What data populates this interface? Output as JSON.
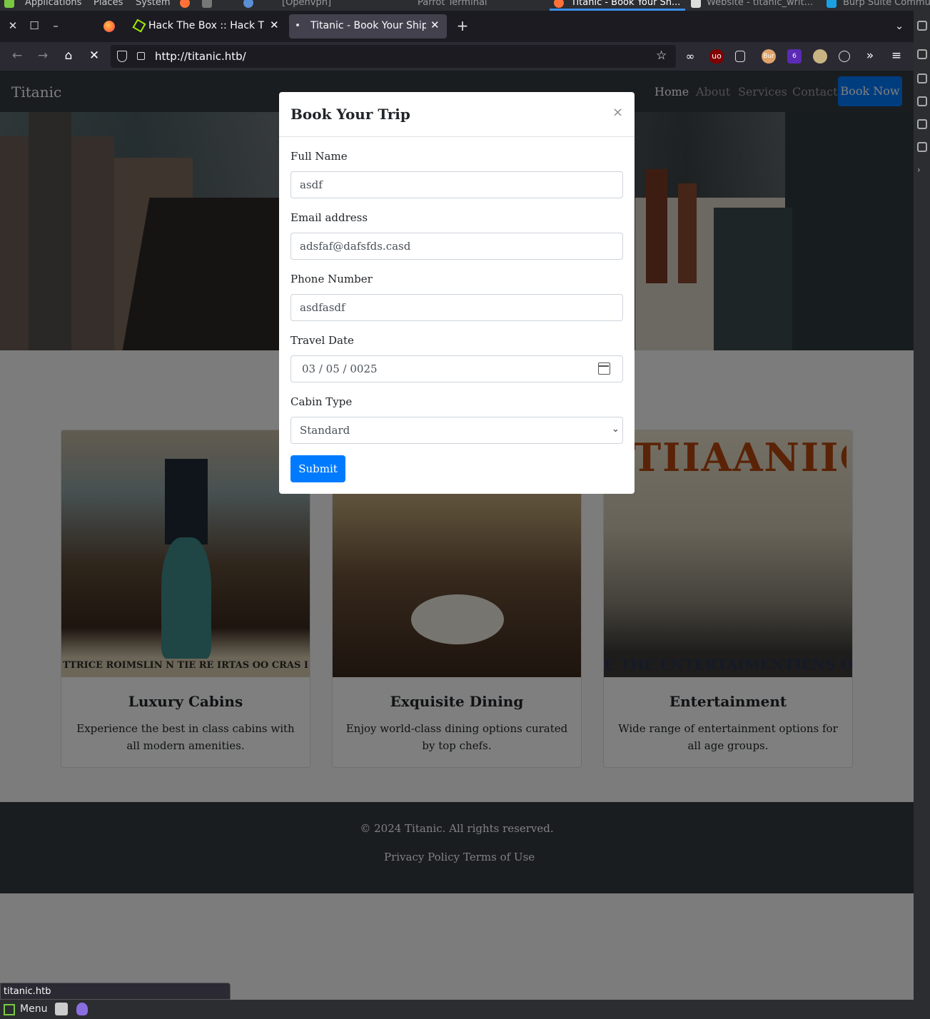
{
  "os_panel": {
    "items": [
      "Applications",
      "Places",
      "System",
      "[Openvpn]",
      "Parrot Terminal",
      "Titanic - Book Your Sh...",
      "Website - titanic_writ...",
      "Burp Suite Commu"
    ]
  },
  "browser": {
    "tabs": [
      {
        "title": "Hack The Box :: Hack The B"
      },
      {
        "title": "Titanic - Book Your Ship T"
      }
    ],
    "url": "http://titanic.htb/",
    "status_url": "titanic.htb"
  },
  "site": {
    "brand": "Titanic",
    "nav": [
      "Home",
      "About",
      "Services",
      "Contact"
    ],
    "book_now": "Book Now",
    "cards": [
      {
        "title": "Luxury Cabins",
        "text": "Experience the best in class cabins with all modern amenities.",
        "banner": "TTRICE ROIMSLIN N TIE RE IRTAS OO CRAS I"
      },
      {
        "title": "Exquisite Dining",
        "text": "Enjoy world-class dining options curated by top chefs.",
        "banner": ""
      },
      {
        "title": "Entertainment",
        "text": "Wide range of entertainment options for all age groups.",
        "banner": "E THE ENTERTAIMENTIENS ON LA",
        "top_banner": "TIIAANIIC"
      }
    ],
    "footer": {
      "copyright": "© 2024 Titanic. All rights reserved.",
      "links": [
        "Privacy Policy",
        "Terms of Use"
      ]
    }
  },
  "modal": {
    "title": "Book Your Trip",
    "close": "×",
    "fields": {
      "full_name": {
        "label": "Full Name",
        "value": "asdf"
      },
      "email": {
        "label": "Email address",
        "value": "adsfaf@dafsfds.casd"
      },
      "phone": {
        "label": "Phone Number",
        "value": "asdfasdf"
      },
      "travel_date": {
        "label": "Travel Date",
        "value": "03 / 05 / 0025"
      },
      "cabin_type": {
        "label": "Cabin Type",
        "value": "Standard"
      }
    },
    "submit": "Submit"
  },
  "taskbar": {
    "menu": "Menu"
  },
  "colors": {
    "primary": "#007bff",
    "navbar": "#343a40"
  }
}
